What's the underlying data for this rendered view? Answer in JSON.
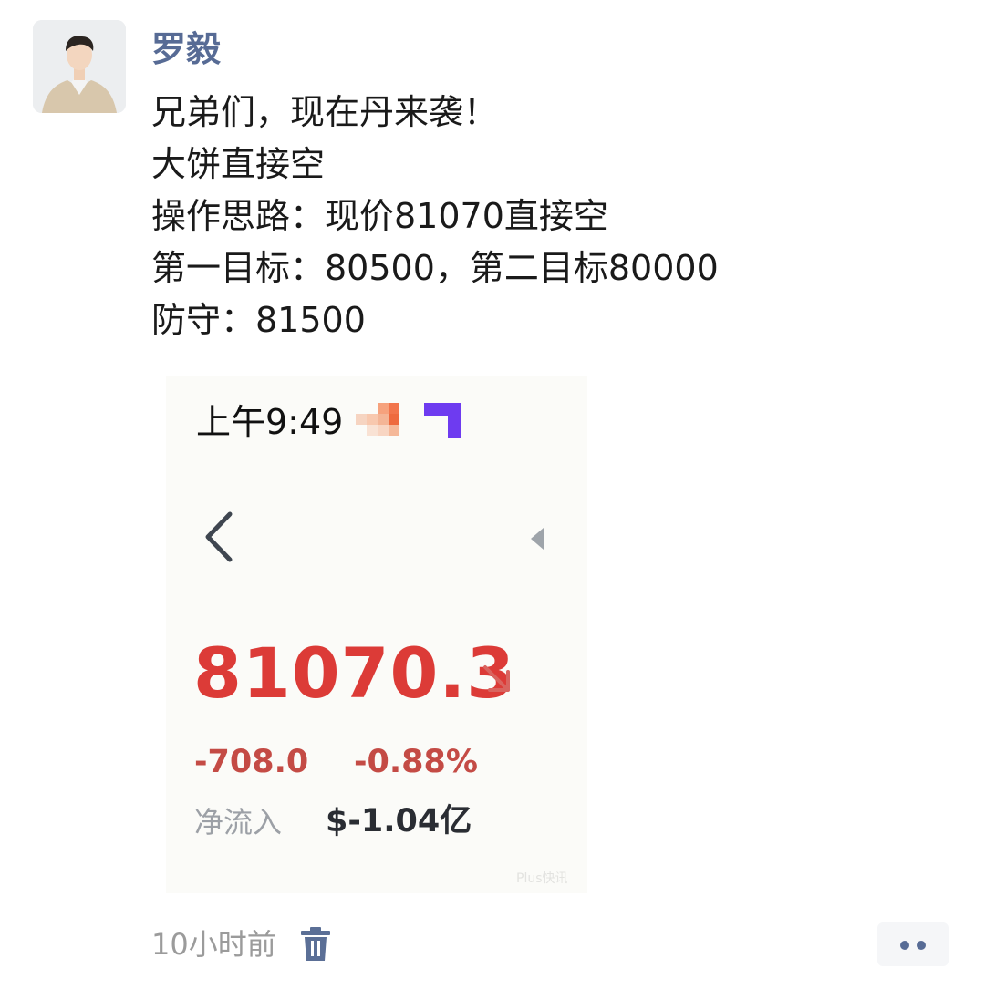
{
  "author": {
    "name": "罗毅"
  },
  "post": {
    "lines": [
      "兄弟们，现在丹来袭！",
      "大饼直接空",
      "操作思路：现价81070直接空",
      "第一目标：80500，第二目标80000",
      "防守：81500"
    ]
  },
  "screenshot": {
    "status_time": "上午9:49",
    "status_icons": [
      "blurred-notification-icon",
      "app-notification-icon"
    ],
    "back_icon": "chevron-left-icon",
    "side_icon": "triangle-left-icon",
    "price": "81070.3",
    "trend_icon": "arrow-down-right-icon",
    "change_abs": "-708.0",
    "change_pct": "-0.88%",
    "inflow_label": "净流入",
    "inflow_value": "$-1.04亿",
    "watermark": "Plus快讯",
    "colors": {
      "price": "#dc3b37",
      "change": "#c44b45",
      "app_icon": "#6e3bf0"
    }
  },
  "footer": {
    "time": "10小时前",
    "delete_icon": "trash-icon",
    "more_icon": "more-dots-icon"
  },
  "colors": {
    "author_name": "#576b95",
    "timestamp": "#9b9b9b"
  }
}
